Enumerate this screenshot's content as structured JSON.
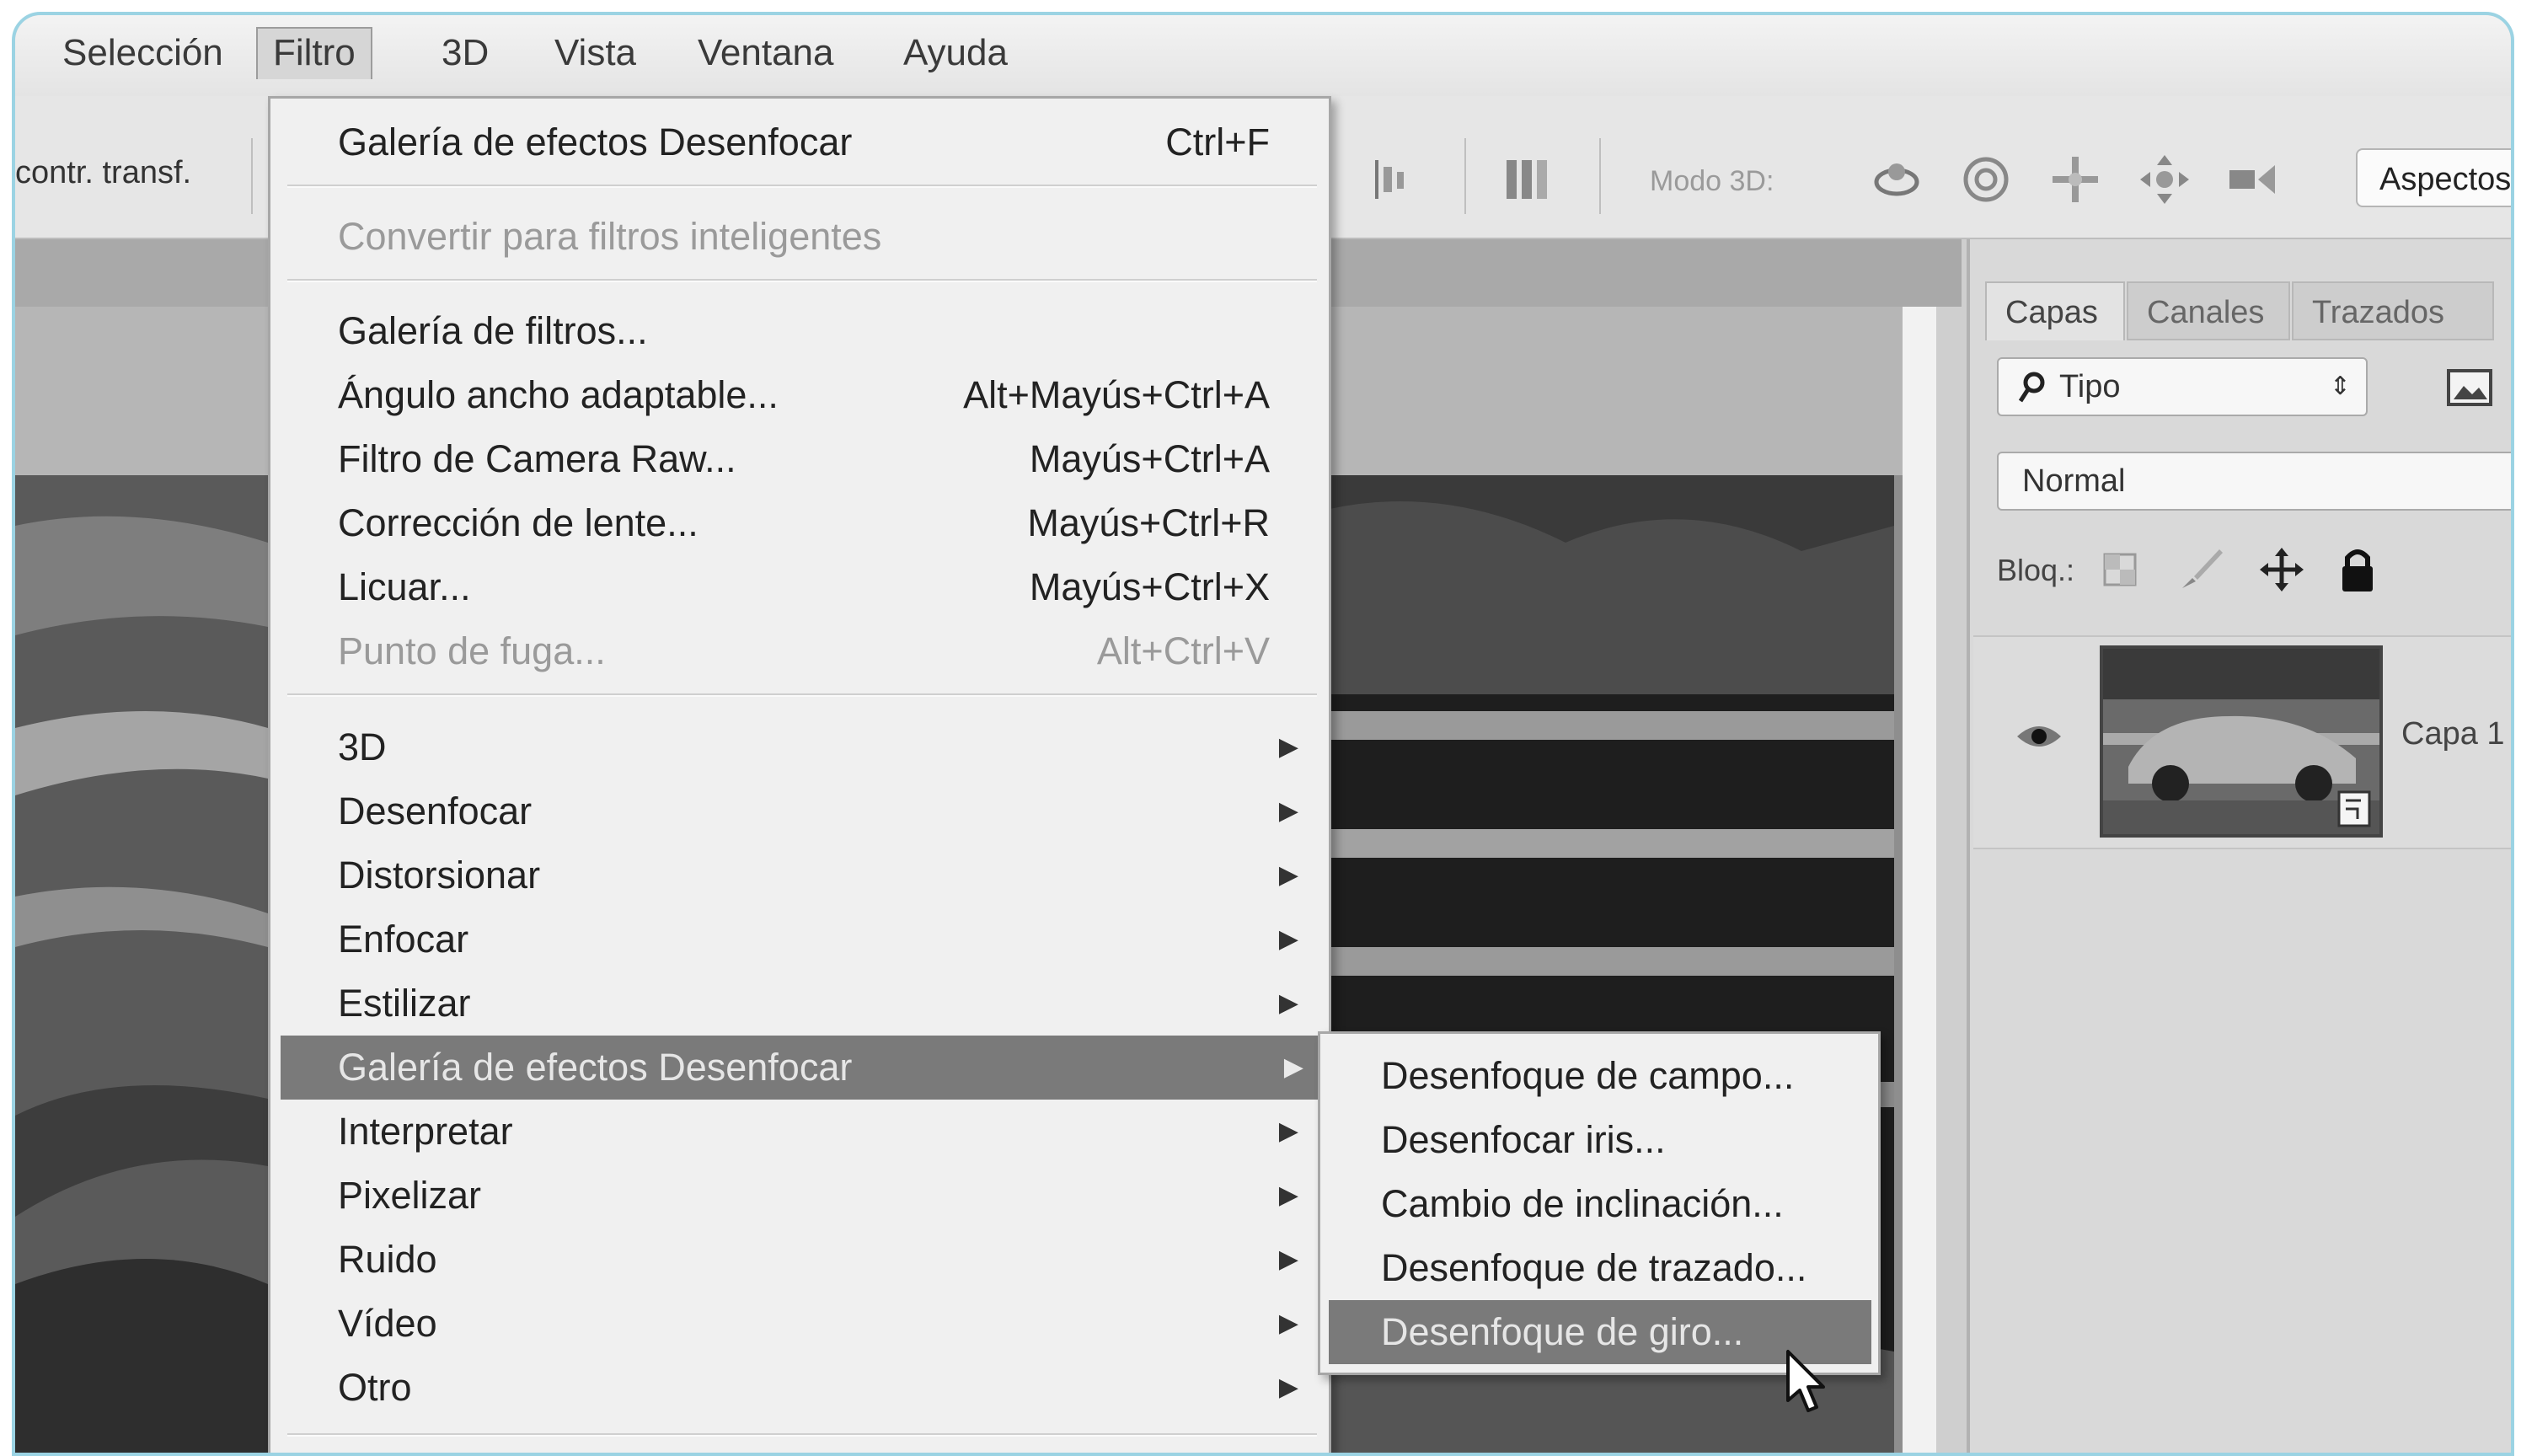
{
  "menubar": {
    "items": [
      "Selección",
      "Filtro",
      "3D",
      "Vista",
      "Ventana",
      "Ayuda"
    ],
    "active": "Filtro"
  },
  "options_bar": {
    "left_label": "contr. transf.",
    "mode_label": "Modo 3D:",
    "workspace_label": "Aspectos",
    "icons": [
      "distribute-left-icon",
      "distribute-center-icon",
      "auto-align-icon",
      "rotate-3d-icon",
      "roll-3d-icon",
      "drag-3d-icon",
      "slide-3d-icon",
      "scale-3d-icon"
    ]
  },
  "filter_menu": {
    "top": [
      {
        "label": "Galería de efectos Desenfocar",
        "shortcut": "Ctrl+F"
      }
    ],
    "smart": [
      {
        "label": "Convertir para filtros inteligentes",
        "disabled": true
      }
    ],
    "gallery": [
      {
        "label": "Galería de filtros...",
        "shortcut": ""
      },
      {
        "label": "Ángulo ancho adaptable...",
        "shortcut": "Alt+Mayús+Ctrl+A"
      },
      {
        "label": "Filtro de Camera Raw...",
        "shortcut": "Mayús+Ctrl+A"
      },
      {
        "label": "Corrección de lente...",
        "shortcut": "Mayús+Ctrl+R"
      },
      {
        "label": "Licuar...",
        "shortcut": "Mayús+Ctrl+X"
      },
      {
        "label": "Punto de fuga...",
        "shortcut": "Alt+Ctrl+V",
        "disabled": true
      }
    ],
    "submenus": [
      "3D",
      "Desenfocar",
      "Distorsionar",
      "Enfocar",
      "Estilizar",
      "Galería de efectos Desenfocar",
      "Interpretar",
      "Pixelizar",
      "Ruido",
      "Vídeo",
      "Otro"
    ],
    "highlighted": "Galería de efectos Desenfocar"
  },
  "blur_gallery_submenu": {
    "items": [
      "Desenfoque de campo...",
      "Desenfocar iris...",
      "Cambio de inclinación...",
      "Desenfoque de trazado...",
      "Desenfoque de giro..."
    ],
    "highlighted": "Desenfoque de giro..."
  },
  "layers_panel": {
    "tabs": [
      "Capas",
      "Canales",
      "Trazados"
    ],
    "active_tab": "Capas",
    "filter_kind": "Tipo",
    "blend_mode": "Normal",
    "lock_label": "Bloq.:",
    "layer_name": "Capa 1"
  }
}
